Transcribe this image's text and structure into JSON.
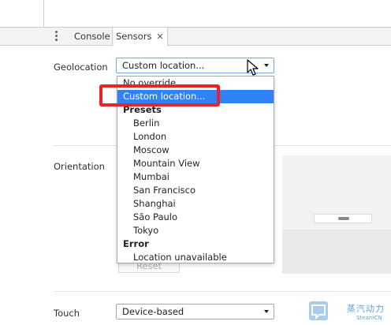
{
  "tabs": {
    "console_label": "Console",
    "sensors_label": "Sensors",
    "close_glyph": "✕"
  },
  "geolocation": {
    "label": "Geolocation",
    "selected_value": "Custom location...",
    "options": [
      {
        "label": "No override",
        "kind": "option"
      },
      {
        "label": "Custom location...",
        "kind": "option",
        "selected": true
      },
      {
        "label": "Presets",
        "kind": "group"
      },
      {
        "label": "Berlin",
        "kind": "sub"
      },
      {
        "label": "London",
        "kind": "sub"
      },
      {
        "label": "Moscow",
        "kind": "sub"
      },
      {
        "label": "Mountain View",
        "kind": "sub"
      },
      {
        "label": "Mumbai",
        "kind": "sub"
      },
      {
        "label": "San Francisco",
        "kind": "sub"
      },
      {
        "label": "Shanghai",
        "kind": "sub"
      },
      {
        "label": "São Paulo",
        "kind": "sub"
      },
      {
        "label": "Tokyo",
        "kind": "sub"
      },
      {
        "label": "Error",
        "kind": "group"
      },
      {
        "label": "Location unavailable",
        "kind": "sub"
      }
    ]
  },
  "orientation": {
    "label": "Orientation",
    "reset_label": "Reset"
  },
  "touch": {
    "label": "Touch",
    "selected_value": "Device-based"
  },
  "watermark": {
    "title": "蒸汽动力",
    "subtitle": "SteamCN"
  },
  "colors": {
    "selection": "#2f83f5",
    "highlight": "#e8242a"
  }
}
